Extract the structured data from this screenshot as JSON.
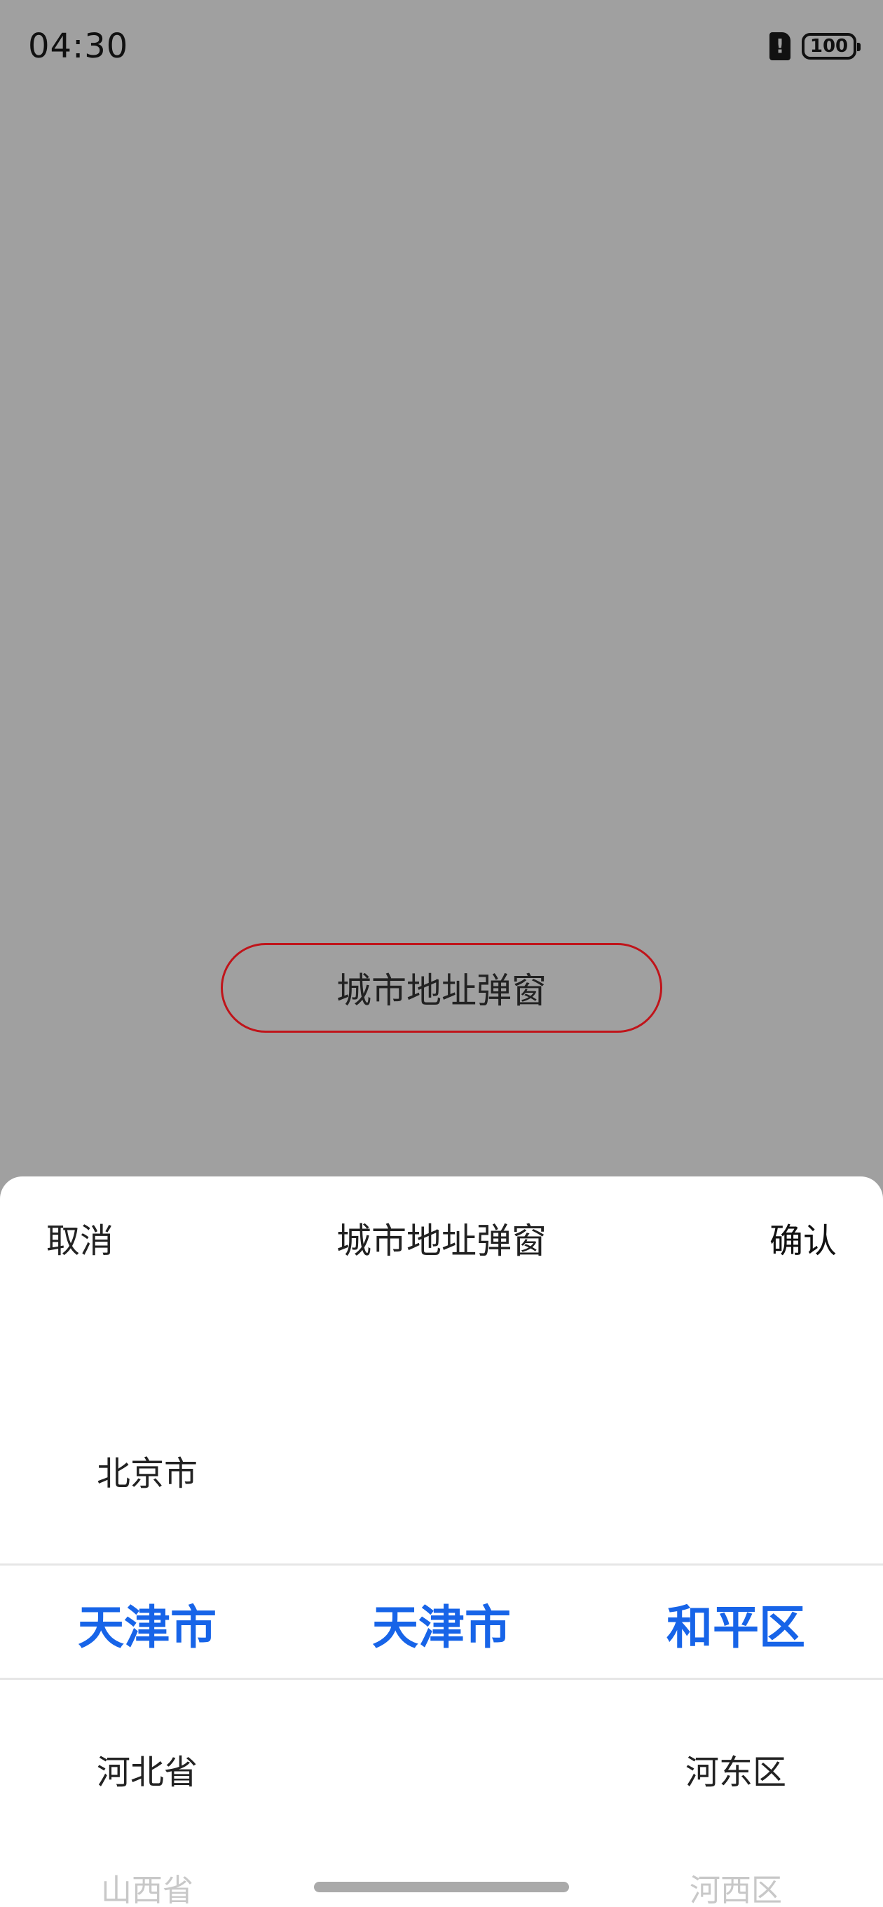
{
  "status_bar": {
    "time": "04:30",
    "battery_level": "100"
  },
  "trigger_button": {
    "label": "城市地址弹窗"
  },
  "sheet": {
    "cancel_label": "取消",
    "title": "城市地址弹窗",
    "confirm_label": "确认"
  },
  "picker": {
    "province": {
      "prev": "北京市",
      "selected": "天津市",
      "next": "河北省",
      "next2": "山西省"
    },
    "city": {
      "prev": "",
      "selected": "天津市",
      "next": "",
      "next2": ""
    },
    "district": {
      "prev": "",
      "selected": "和平区",
      "next": "河东区",
      "next2": "河西区"
    }
  },
  "colors": {
    "selected_text": "#1764e8",
    "trigger_border": "#c0141a",
    "backdrop": "#a0a0a0"
  }
}
